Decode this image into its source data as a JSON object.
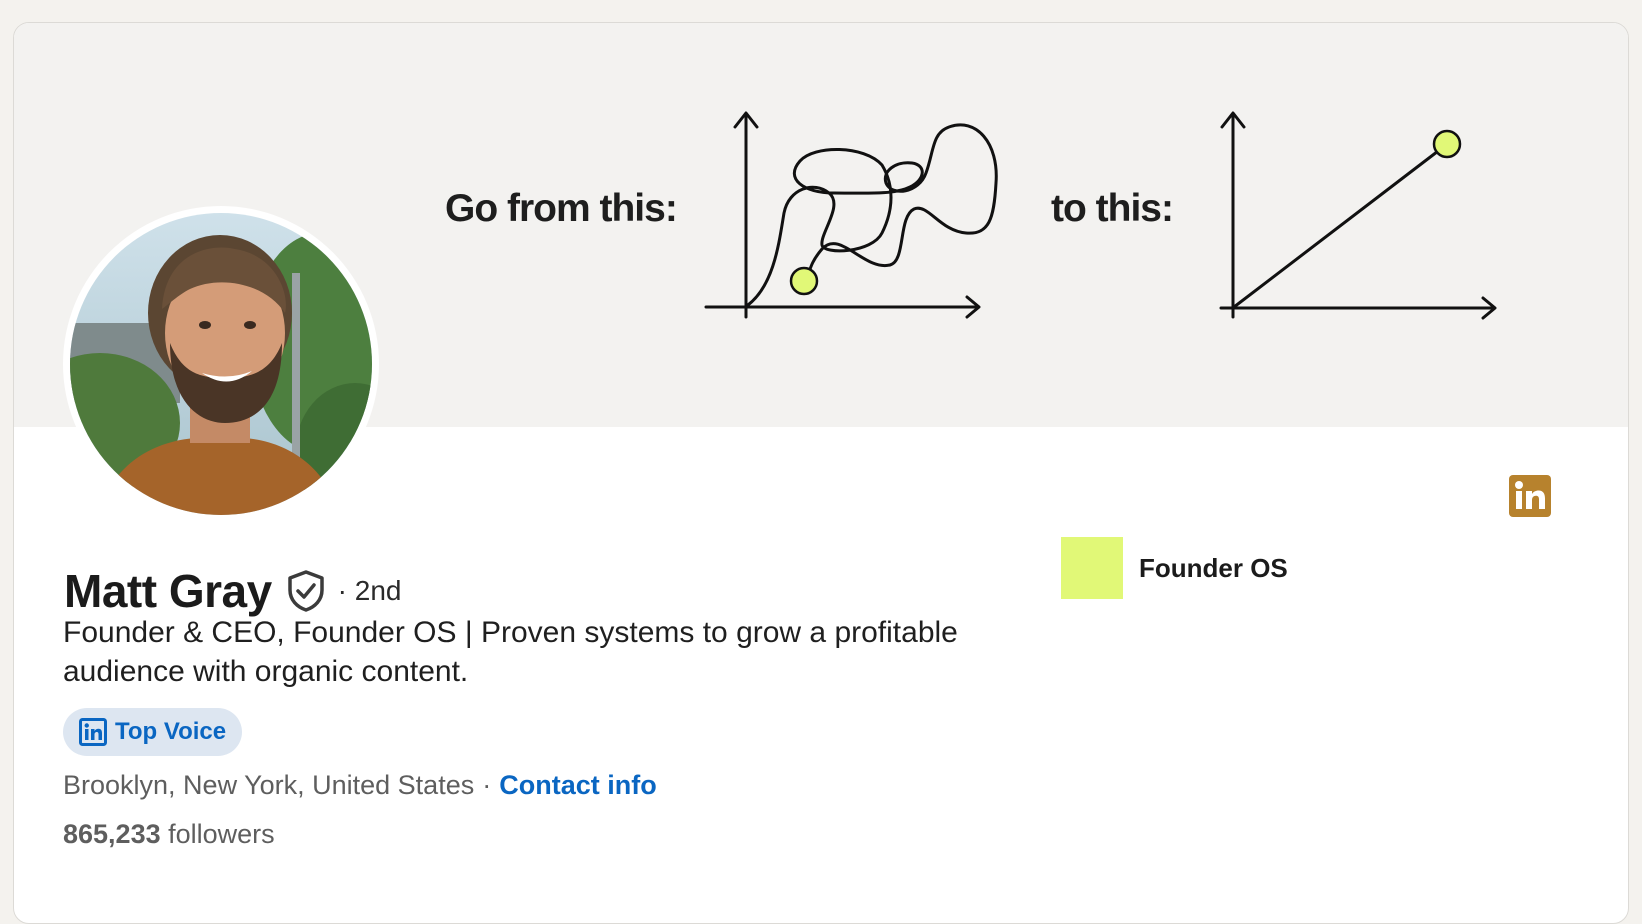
{
  "banner": {
    "text_left": "Go from this:",
    "text_right": "to this:",
    "accent_color": "#e1f877"
  },
  "profile": {
    "name": "Matt Gray",
    "degree": "· 2nd",
    "headline": "Founder & CEO, Founder OS | Proven systems to grow a profitable audience with organic content.",
    "badge": {
      "icon": "linkedin-icon",
      "label": "Top Voice"
    },
    "location": "Brooklyn, New York, United States",
    "separator": "·",
    "contact_label": "Contact info",
    "followers_count": "865,233",
    "followers_label": "followers"
  },
  "company": {
    "name": "Founder OS",
    "logo_color": "#e1f877"
  },
  "icons": {
    "verified": "verified-shield-icon",
    "linkedin": "linkedin-logo-icon"
  },
  "colors": {
    "link": "#0a66c2",
    "linkedin_brand": "#b7822d",
    "badge_bg": "#dde6f1"
  }
}
